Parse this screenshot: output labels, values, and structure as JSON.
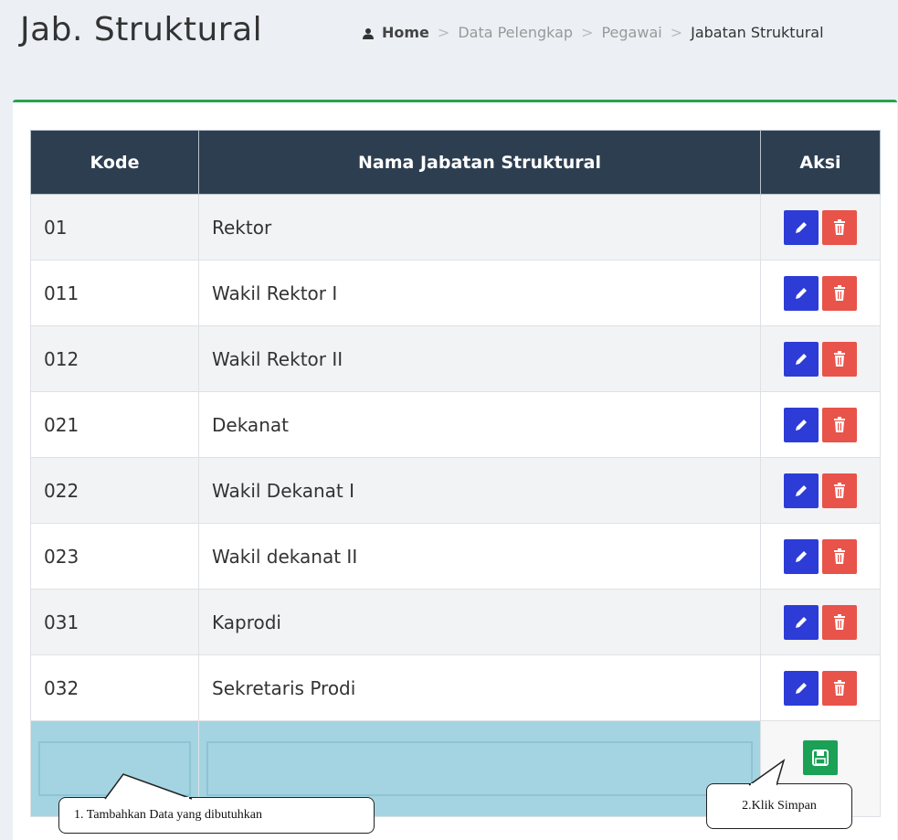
{
  "header": {
    "title": "Jab. Struktural",
    "breadcrumb": [
      "Home",
      "Data Pelengkap",
      "Pegawai",
      "Jabatan Struktural"
    ],
    "separator": ">"
  },
  "table": {
    "columns": [
      "Kode",
      "Nama Jabatan Struktural",
      "Aksi"
    ],
    "rows": [
      {
        "kode": "01",
        "nama": "Rektor"
      },
      {
        "kode": "011",
        "nama": "Wakil Rektor I"
      },
      {
        "kode": "012",
        "nama": "Wakil Rektor II"
      },
      {
        "kode": "021",
        "nama": "Dekanat"
      },
      {
        "kode": "022",
        "nama": "Wakil Dekanat I"
      },
      {
        "kode": "023",
        "nama": "Wakil dekanat II"
      },
      {
        "kode": "031",
        "nama": "Kaprodi"
      },
      {
        "kode": "032",
        "nama": "Sekretaris Prodi"
      }
    ],
    "add_row": {
      "kode_value": "",
      "nama_value": ""
    }
  },
  "callouts": {
    "step1": "1.   Tambahkan Data yang dibutuhkan",
    "step2": "2.Klik Simpan"
  },
  "colors": {
    "header_bg": "#2c3e50",
    "accent_border": "#27a34a",
    "edit_button": "#2d3cd6",
    "delete_button": "#e8534a",
    "save_button": "#1aa156",
    "input_highlight": "#a4d4e1"
  },
  "icons": {
    "breadcrumb": "home-icon",
    "edit": "pencil-icon",
    "delete": "trash-icon",
    "save": "floppy-disk-icon"
  }
}
